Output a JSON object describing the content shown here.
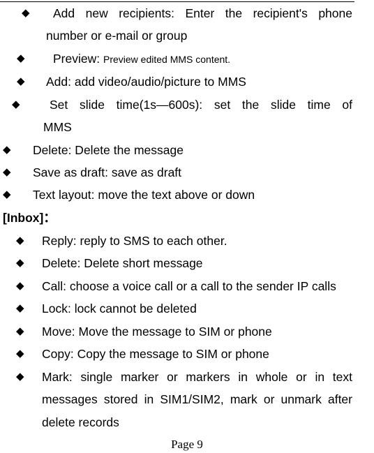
{
  "document": {
    "section_a_items": [
      {
        "label": "Add new recipients:",
        "text_line1": "Add new recipients: Enter the recipient's phone",
        "text_line2": "number or e-mail or group"
      },
      {
        "label": "Preview:",
        "text": "Preview edited MMS content."
      },
      {
        "text": "Add: add video/audio/picture to MMS"
      },
      {
        "text_line1": "Set slide time(1s—600s): set the slide time of",
        "text_line2": "MMS"
      },
      {
        "text": "Delete: Delete the message"
      },
      {
        "text": "Save as draft: save as draft"
      },
      {
        "text": "Text layout: move the text above or down"
      }
    ],
    "inbox_heading": "[Inbox]：",
    "inbox_items": [
      {
        "text": "Reply: reply to SMS to each other."
      },
      {
        "text": "Delete: Delete short message"
      },
      {
        "text": "Call: choose a voice call or a call to the sender IP calls"
      },
      {
        "text": "Lock: lock cannot be deleted"
      },
      {
        "text": "Move: Move the message to SIM or phone"
      },
      {
        "text": "Copy: Copy the message to SIM or phone"
      },
      {
        "text_line1": "Mark: single marker or markers in whole or in text",
        "text_line2": "messages stored in SIM1/SIM2, mark or unmark after",
        "text_line3": "delete records"
      }
    ],
    "bullet_icon": "black-diamond",
    "bullet_glyph": "◆",
    "footer": "Page 9"
  }
}
